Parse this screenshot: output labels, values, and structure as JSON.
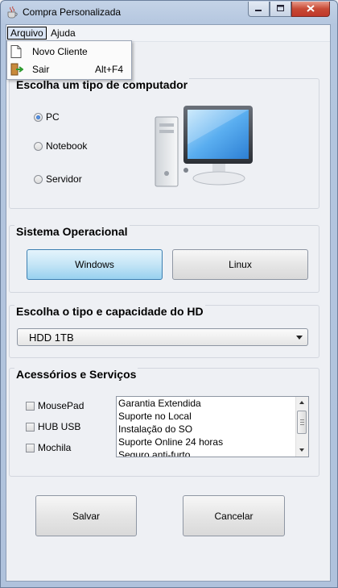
{
  "window": {
    "title": "Compra Personalizada",
    "controls": [
      "minimize-icon",
      "maximize-icon",
      "close-icon"
    ]
  },
  "menubar": {
    "items": [
      {
        "label": "Arquivo",
        "active": true
      },
      {
        "label": "Ajuda",
        "active": false
      }
    ]
  },
  "dropdown": {
    "items": [
      {
        "label": "Novo Cliente",
        "accelerator": "",
        "icon": "new-document-icon"
      },
      {
        "label": "Sair",
        "accelerator": "Alt+F4",
        "icon": "exit-door-icon"
      }
    ]
  },
  "computer_type": {
    "title": "Escolha um tipo de computador",
    "options": [
      "PC",
      "Notebook",
      "Servidor"
    ],
    "selected": "PC",
    "image": "desktop-computer-icon"
  },
  "os": {
    "title": "Sistema Operacional",
    "options": [
      "Windows",
      "Linux"
    ],
    "selected": "Windows"
  },
  "hd": {
    "title": "Escolha o tipo e capacidade do HD",
    "selected": "HDD 1TB"
  },
  "accessories": {
    "title": "Acessórios e Serviços",
    "checkboxes": [
      "MousePad",
      "HUB USB",
      "Mochila"
    ],
    "services": [
      "Garantia Extendida",
      "Suporte no Local",
      "Instalação do SO",
      "Suporte Online 24 horas",
      "Seguro anti-furto"
    ]
  },
  "actions": {
    "save": "Salvar",
    "cancel": "Cancelar"
  },
  "colors": {
    "selected_button": "#98d1ef",
    "close_button": "#c74a35"
  }
}
